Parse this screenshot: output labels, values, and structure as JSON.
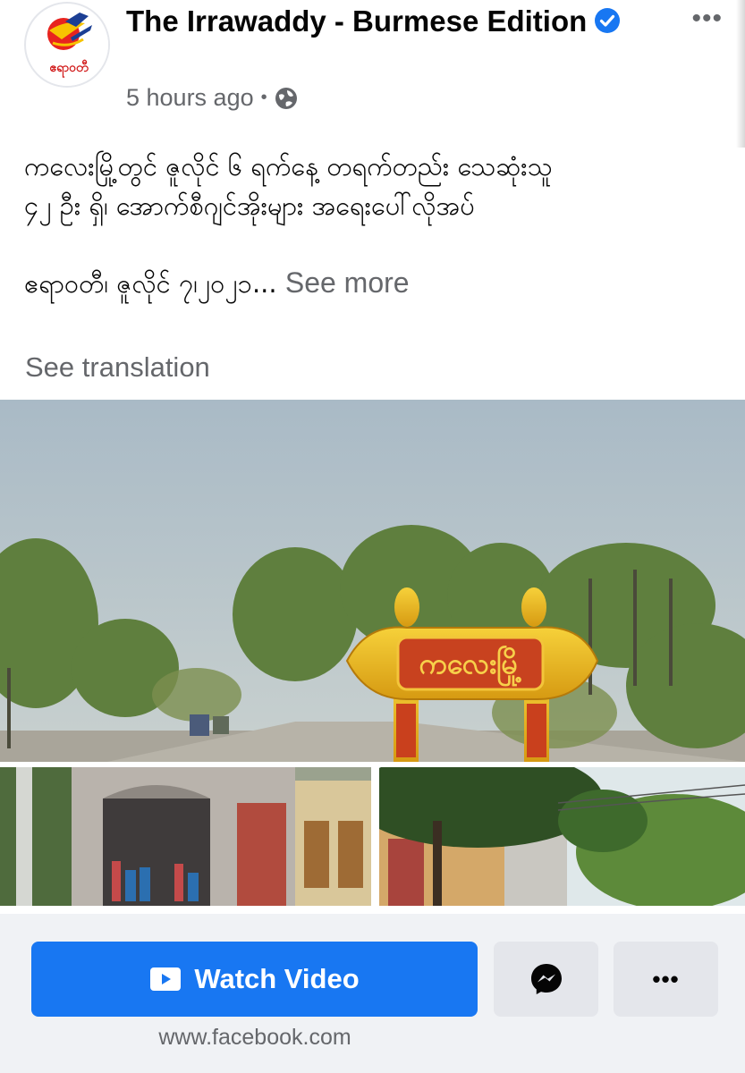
{
  "header": {
    "page_name": "The Irrawaddy - Burmese Edition",
    "timestamp": "5 hours ago",
    "separator": "•",
    "audience_icon": "globe-icon",
    "avatar_text": "ဧရာဝတီ",
    "more_label": "•••"
  },
  "post": {
    "line1": "ကလေးမြို့တွင် ဇူလိုင် ၆ ရက်နေ့ တရက်တည်း သေဆုံးသူ",
    "line2": "၄၂ ဦး ရှိ၊ အောက်စီဂျင်အိုးများ အရေးပေါ်လိုအပ်",
    "line3": "ဧရာဝတီ၊ ဇူလိုင် ၇၊၂၀၂၁...",
    "see_more": "See more",
    "see_translation": "See translation"
  },
  "photo": {
    "sign_text": "ကလေးမြို့"
  },
  "cta": {
    "watch_label": "Watch Video",
    "domain": "www.facebook.com",
    "more_label": "•••"
  },
  "colors": {
    "primary": "#1877f2",
    "secondary_text": "#65676b",
    "bar_bg": "#f0f2f5",
    "button_grey": "#e4e6eb"
  }
}
